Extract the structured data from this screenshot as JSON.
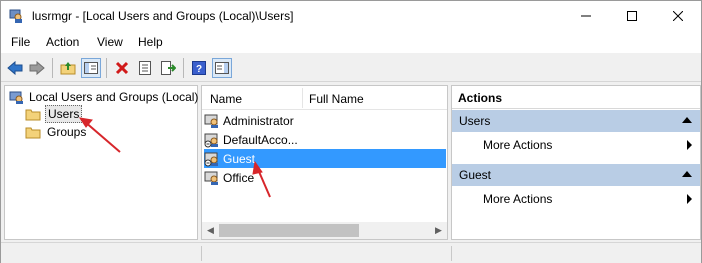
{
  "window": {
    "title": "lusrmgr - [Local Users and Groups (Local)\\Users]"
  },
  "menu": [
    "File",
    "Action",
    "View",
    "Help"
  ],
  "toolbar": {
    "buttons": [
      "back-icon",
      "forward-icon",
      "up-folder-icon",
      "show-hide-tree-icon",
      "delete-icon",
      "properties-icon",
      "export-list-icon",
      "help-icon",
      "show-hide-action-pane-icon"
    ]
  },
  "tree": {
    "root_label": "Local Users and Groups (Local)",
    "children": [
      {
        "label": "Users",
        "selected": true
      },
      {
        "label": "Groups",
        "selected": false
      }
    ]
  },
  "list": {
    "columns": [
      "Name",
      "Full Name"
    ],
    "rows": [
      {
        "name": "Administrator",
        "full_name": "",
        "selected": false
      },
      {
        "name": "DefaultAcco...",
        "full_name": "",
        "selected": false
      },
      {
        "name": "Guest",
        "full_name": "",
        "selected": true
      },
      {
        "name": "Office",
        "full_name": "",
        "selected": false
      }
    ]
  },
  "actions": {
    "header": "Actions",
    "sections": [
      {
        "title": "Users",
        "items": [
          "More Actions"
        ]
      },
      {
        "title": "Guest",
        "items": [
          "More Actions"
        ]
      }
    ]
  },
  "colors": {
    "selection": "#3399ff",
    "actions_section": "#b9cde5",
    "annotation_arrow": "#d7262b"
  }
}
